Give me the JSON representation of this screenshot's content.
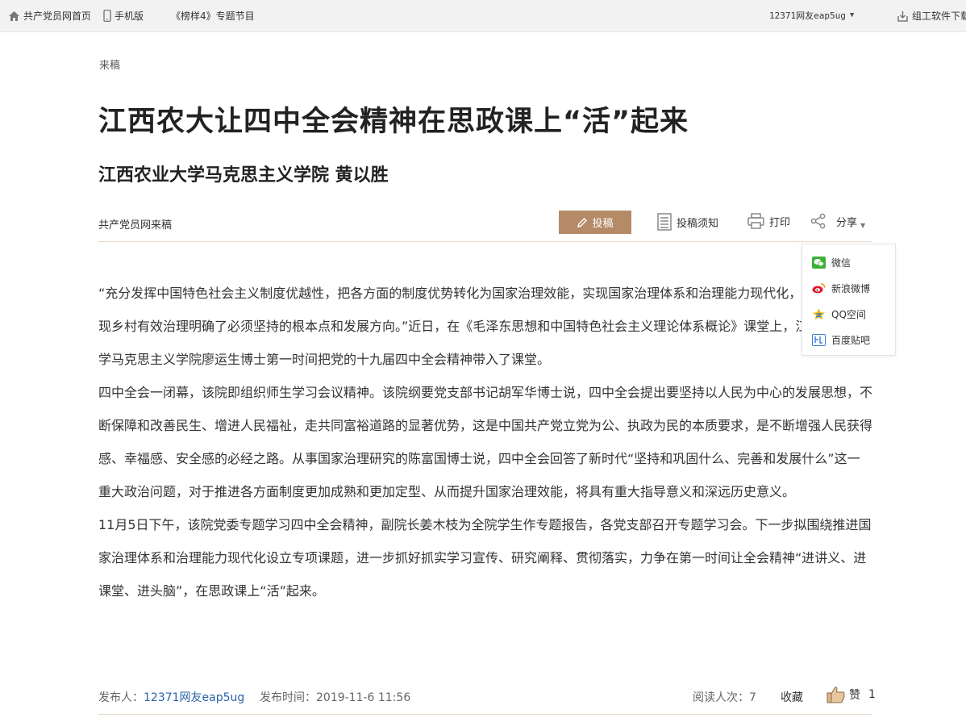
{
  "topbar": {
    "home_label": "共产党员网首页",
    "mobile_label": "手机版",
    "program_label": "《榜样4》专题节目",
    "user_label": "12371网友eap5ug",
    "download_label": "组工软件下载"
  },
  "article": {
    "crumb": "来稿",
    "title": "江西农大让四中全会精神在思政课上“活”起来",
    "subtitle": "江西农业大学马克思主义学院 黄以胜",
    "source": "共产党员网来稿",
    "submit_label": "投稿",
    "notice_label": "投稿须知",
    "print_label": "打印",
    "share_label": "分享",
    "paragraphs": [
      "“充分发挥中国特色社会主义制度优越性，把各方面的制度优势转化为国家治理效能，实现国家治理体系和治理能力现代化，这为今后实现乡村有效治理明确了必须坚持的根本点和发展方向。”近日，在《毛泽东思想和中国特色社会主义理论体系概论》课堂上，江西农业大学马克思主义学院廖运生博士第一时间把党的十九届四中全会精神带入了课堂。",
      "四中全会一闭幕，该院即组织师生学习会议精神。该院纲要党支部书记胡军华博士说，四中全会提出要坚持以人民为中心的发展思想，不断保障和改善民生、增进人民福祉，走共同富裕道路的显著优势，这是中国共产党立党为公、执政为民的本质要求，是不断增强人民获得感、幸福感、安全感的必经之路。从事国家治理研究的陈富国博士说，四中全会回答了新时代“坚持和巩固什么、完善和发展什么”这一重大政治问题，对于推进各方面制度更加成熟和更加定型、从而提升国家治理效能，将具有重大指导意义和深远历史意义。",
      "11月5日下午，该院党委专题学习四中全会精神，副院长姜木枝为全院学生作专题报告，各党支部召开专题学习会。下一步拟围绕推进国家治理体系和治理能力现代化设立专项课题，进一步抓好抓实学习宣传、研究阐释、贯彻落实，力争在第一时间让全会精神“进讲义、进课堂、进头脑”，在思政课上“活”起来。"
    ]
  },
  "share_menu": {
    "items": [
      {
        "label": "微信",
        "icon": "wechat-icon",
        "color": "#3cb034"
      },
      {
        "label": "新浪微博",
        "icon": "weibo-icon",
        "color": "#e6162d"
      },
      {
        "label": "QQ空间",
        "icon": "qzone-icon",
        "color": "#f5b400"
      },
      {
        "label": "百度贴吧",
        "icon": "tieba-icon",
        "color": "#3b7ed6"
      }
    ]
  },
  "footer": {
    "publisher_label": "发布人：",
    "publisher_name": "12371网友eap5ug",
    "time_label": "发布时间：2019-11-6 11:56",
    "reads_label": "阅读人次：7",
    "favorite_label": "收藏",
    "like_label": "赞",
    "like_count": "1"
  },
  "colors": {
    "accent": "#b58a66",
    "divider": "#e8d9c8",
    "link": "#2a63a8"
  }
}
